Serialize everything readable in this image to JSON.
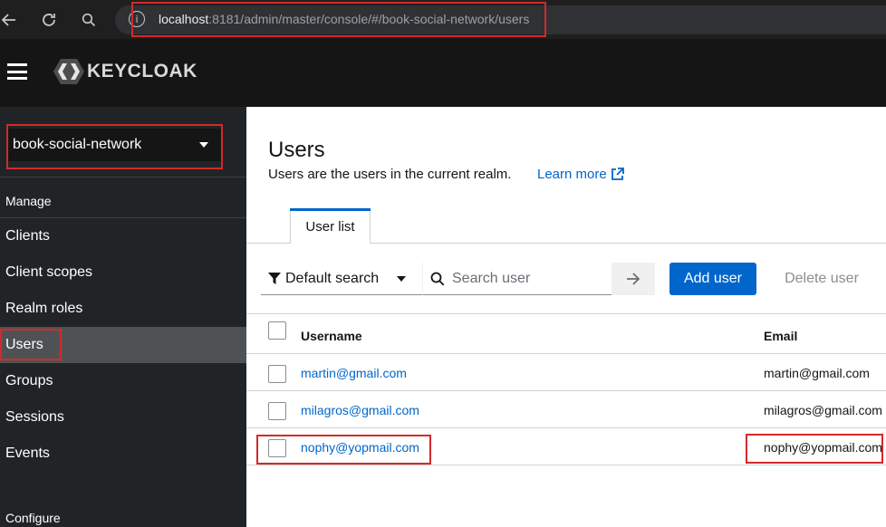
{
  "browser": {
    "url_host": "localhost",
    "url_rest": ":8181/admin/master/console/#/book-social-network/users"
  },
  "header": {
    "logo_text": "KEYCLOAK"
  },
  "sidebar": {
    "realm": "book-social-network",
    "manage_label": "Manage",
    "configure_label": "Configure",
    "items": [
      {
        "label": "Clients"
      },
      {
        "label": "Client scopes"
      },
      {
        "label": "Realm roles"
      },
      {
        "label": "Users",
        "active": true
      },
      {
        "label": "Groups"
      },
      {
        "label": "Sessions"
      },
      {
        "label": "Events"
      }
    ]
  },
  "main": {
    "title": "Users",
    "description": "Users are the users in the current realm.",
    "learn_more": "Learn more",
    "tab_user_list": "User list",
    "toolbar": {
      "filter_label": "Default search",
      "search_placeholder": "Search user",
      "add_user": "Add user",
      "delete_user": "Delete user"
    },
    "table": {
      "columns": [
        "Username",
        "Email"
      ],
      "rows": [
        {
          "username": "martin@gmail.com",
          "email": "martin@gmail.com"
        },
        {
          "username": "milagros@gmail.com",
          "email": "milagros@gmail.com"
        },
        {
          "username": "nophy@yopmail.com",
          "email": "nophy@yopmail.com"
        }
      ]
    }
  },
  "colors": {
    "accent": "#0066cc",
    "annotation": "#d22a2a",
    "sidebar_bg": "#212427",
    "header_bg": "#151515"
  }
}
